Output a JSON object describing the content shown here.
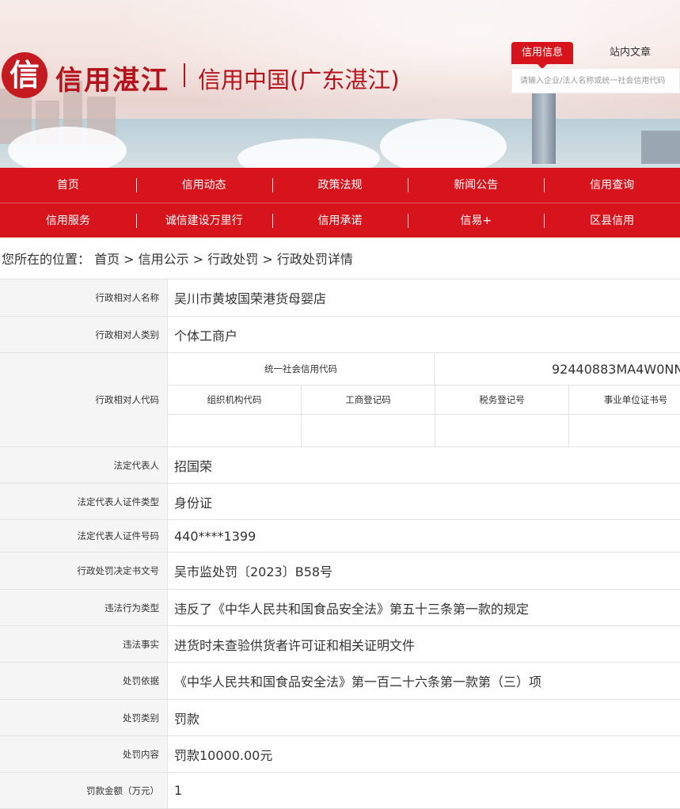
{
  "brand": {
    "logo_char": "信",
    "title": "信用湛江",
    "subtitle": "信用中国(广东湛江)"
  },
  "search": {
    "tabs": [
      "信用信息",
      "站内文章"
    ],
    "active_tab": "信用信息",
    "placeholder": "请输入企业/法人名称或统一社会信用代码"
  },
  "nav": {
    "row1": [
      "首页",
      "信用动态",
      "政策法规",
      "新闻公告",
      "信用查询"
    ],
    "row2": [
      "信用服务",
      "诚信建设万里行",
      "信用承诺",
      "信易+",
      "区县信用"
    ]
  },
  "breadcrumb": "您所在的位置： 首页 > 信用公示 > 行政处罚 > 行政处罚详情",
  "detail": {
    "name_label": "行政相对人名称",
    "name_value": "吴川市黄坡国荣港货母婴店",
    "category_label": "行政相对人类别",
    "category_value": "个体工商户",
    "code_label": "行政相对人代码",
    "uscc_label": "统一社会信用代码",
    "uscc_value": "92440883MA4W0NN",
    "code_headers": [
      "组织机构代码",
      "工商登记码",
      "税务登记号",
      "事业单位证书号"
    ],
    "code_values": [
      "",
      "",
      "",
      ""
    ],
    "legal_rep_label": "法定代表人",
    "legal_rep_value": "招国荣",
    "id_type_label": "法定代表人证件类型",
    "id_type_value": "身份证",
    "id_no_label": "法定代表人证件号码",
    "id_no_value": "440****1399",
    "decision_no_label": "行政处罚决定书文号",
    "decision_no_value": "吴市监处罚〔2023〕B58号",
    "violation_type_label": "违法行为类型",
    "violation_type_value": "违反了《中华人民共和国食品安全法》第五十三条第一款的规定",
    "violation_fact_label": "违法事实",
    "violation_fact_value": "进货时未查验供货者许可证和相关证明文件",
    "basis_label": "处罚依据",
    "basis_value": "《中华人民共和国食品安全法》第一百二十六条第一款第（三）项",
    "penalty_type_label": "处罚类别",
    "penalty_type_value": "罚款",
    "penalty_content_label": "处罚内容",
    "penalty_content_value": "罚款10000.00元",
    "fine_label": "罚款金额（万元）",
    "fine_value": "1"
  }
}
